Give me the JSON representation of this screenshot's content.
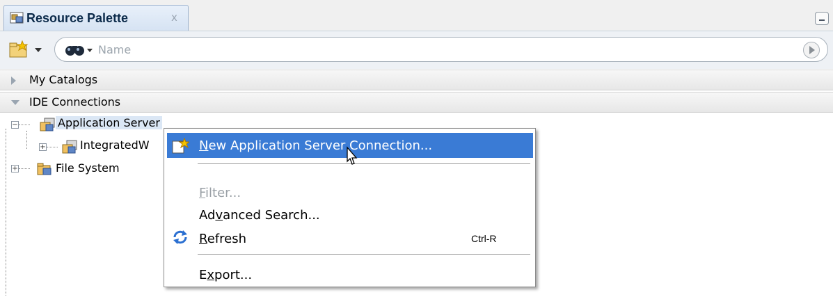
{
  "panel": {
    "tab_title": "Resource Palette",
    "tab_close": "x"
  },
  "toolbar": {
    "search_placeholder": "Name",
    "new_icon": "new-folder-icon",
    "search_scope_icon": "binoculars-icon"
  },
  "sections": {
    "catalogs": "My Catalogs",
    "ide_connections": "IDE Connections"
  },
  "tree": {
    "app_server": "Application Server",
    "integrated": "IntegratedW",
    "file_system": "File System"
  },
  "context_menu": {
    "new_connection": {
      "mnemonic": "N",
      "rest": "ew Application Server Connection..."
    },
    "filter": {
      "mnemonic": "F",
      "rest": "ilter..."
    },
    "advanced_search": {
      "pre": "Ad",
      "mnemonic": "v",
      "rest": "anced Search..."
    },
    "refresh": {
      "mnemonic": "R",
      "rest": "efresh",
      "accelerator": "Ctrl-R"
    },
    "export": {
      "pre": "E",
      "mnemonic": "x",
      "rest": "port..."
    }
  },
  "colors": {
    "highlight": "#3a7bd5",
    "disabled_text": "#9aa0a6",
    "tab_bg": "#d6e3f3"
  }
}
